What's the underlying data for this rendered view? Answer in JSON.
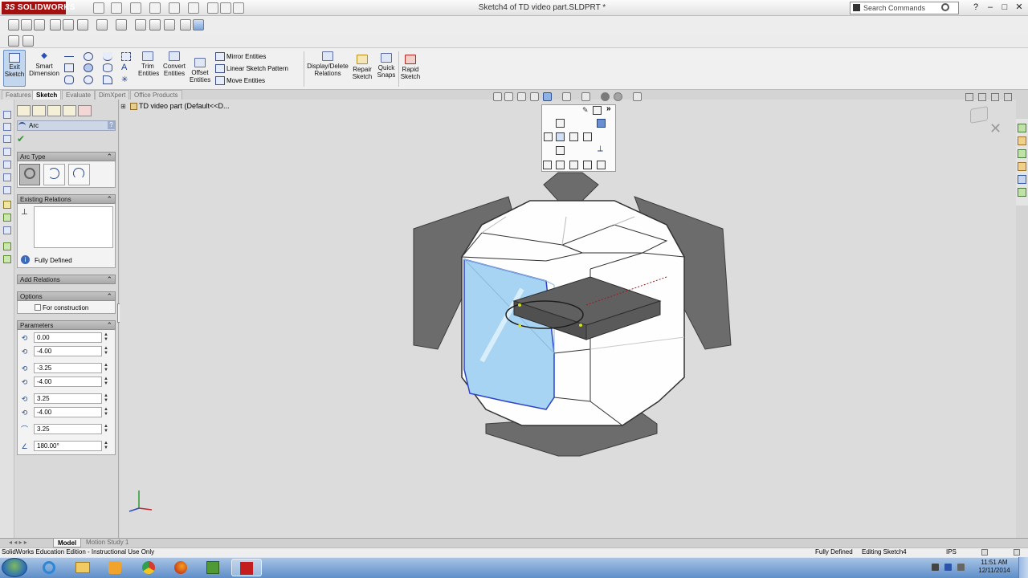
{
  "titlebar": {
    "brand_prefix": "3S",
    "brand": "SOLIDWORKS",
    "document_title": "Sketch4 of TD video part.SLDPRT *",
    "search_placeholder": "Search Commands",
    "win_buttons": [
      "?",
      "–",
      "□",
      "✕"
    ]
  },
  "commandmanager": {
    "exit_sketch": [
      "Exit",
      "Sketch"
    ],
    "smart_dimension": [
      "Smart",
      "Dimension"
    ],
    "trim_entities": [
      "Trim",
      "Entities"
    ],
    "convert_entities": [
      "Convert",
      "Entities"
    ],
    "offset_entities": [
      "Offset",
      "Entities"
    ],
    "mirror_entities": "Mirror Entities",
    "linear_sketch_pattern": "Linear Sketch Pattern",
    "move_entities": "Move Entities",
    "display_delete_relations": [
      "Display/Delete",
      "Relations"
    ],
    "repair_sketch": [
      "Repair",
      "Sketch"
    ],
    "quick_snaps": [
      "Quick",
      "Snaps"
    ],
    "rapid_sketch": [
      "Rapid",
      "Sketch"
    ]
  },
  "tabs": [
    "Features",
    "Sketch",
    "Evaluate",
    "DimXpert",
    "Office Products"
  ],
  "active_tab": "Sketch",
  "feature_tree_root": "TD video part  (Default<<D...",
  "property_manager": {
    "title": "Arc",
    "help": "?",
    "arc_type_header": "Arc Type",
    "existing_relations_header": "Existing Relations",
    "status": "Fully Defined",
    "add_relations_header": "Add Relations",
    "options_header": "Options",
    "for_construction_label": "For construction",
    "parameters_header": "Parameters",
    "parameters": [
      "0.00",
      "-4.00",
      "-3.25",
      "-4.00",
      "3.25",
      "-4.00",
      "3.25",
      "180.00°"
    ]
  },
  "bottom_tabs": [
    "Model",
    "Motion Study 1"
  ],
  "active_bottom_tab": "Model",
  "statusbar": {
    "left": "SolidWorks Education Edition - Instructional Use Only",
    "fully_defined": "Fully Defined",
    "editing": "Editing Sketch4",
    "units": "IPS"
  },
  "taskbar": {
    "time": "11:51 AM",
    "date": "12/11/2014"
  },
  "colors": {
    "brand_red": "#a31010",
    "selected_face": "#a7d4f2",
    "face_edge": "#2c43c9",
    "taskbar": "#6f9bd1"
  }
}
